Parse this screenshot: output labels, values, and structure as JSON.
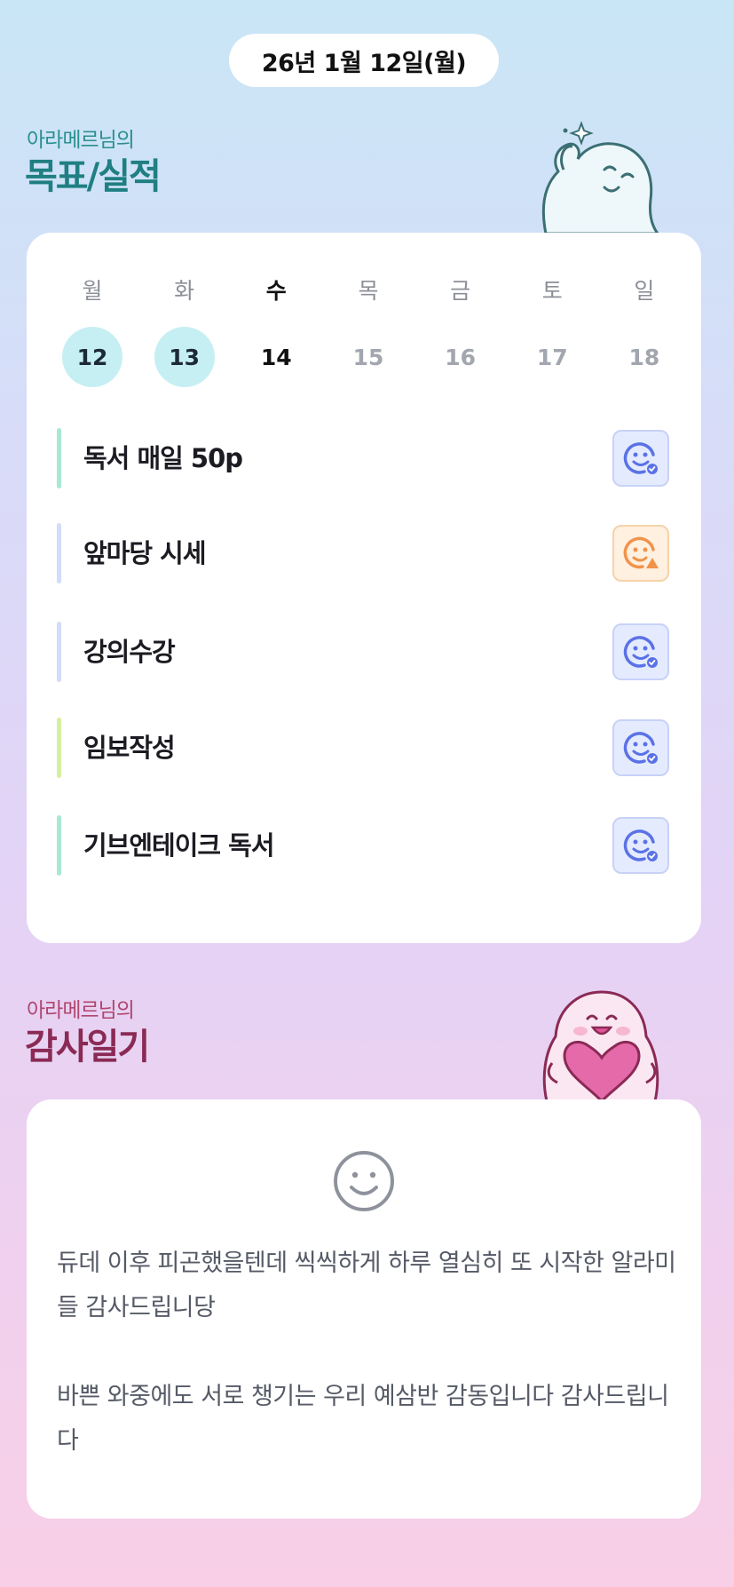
{
  "date_label": "26년 1월 12일(월)",
  "goals_section": {
    "owner": "아라메르님의",
    "title": "목표/실적"
  },
  "week": [
    {
      "name": "월",
      "num": "12",
      "state": "done"
    },
    {
      "name": "화",
      "num": "13",
      "state": "done"
    },
    {
      "name": "수",
      "num": "14",
      "state": "today"
    },
    {
      "name": "목",
      "num": "15",
      "state": "future"
    },
    {
      "name": "금",
      "num": "16",
      "state": "future"
    },
    {
      "name": "토",
      "num": "17",
      "state": "future"
    },
    {
      "name": "일",
      "num": "18",
      "state": "future"
    }
  ],
  "goals": [
    {
      "label": "독서 매일 50p",
      "bar_color": "#a8e8d4",
      "status": "blue",
      "icon": "smile-check-icon"
    },
    {
      "label": "앞마당 시세",
      "bar_color": "#d3dcfa",
      "status": "orange",
      "icon": "smile-warning-icon"
    },
    {
      "label": "강의수강",
      "bar_color": "#d3dcfa",
      "status": "blue",
      "icon": "smile-check-icon"
    },
    {
      "label": "임보작성",
      "bar_color": "#d6ef9e",
      "status": "blue",
      "icon": "smile-check-icon"
    },
    {
      "label": "기브엔테이크 독서",
      "bar_color": "#a8e8d4",
      "status": "blue",
      "icon": "smile-check-icon"
    }
  ],
  "gratitude_section": {
    "owner": "아라메르님의",
    "title": "감사일기"
  },
  "gratitude": {
    "mood_icon": "smile-face-icon",
    "paragraphs": [
      "듀데 이후 피곤했을텐데 씩씩하게 하루 열심히 또 시작한 알라미들 감사드립니당",
      "바쁜 와중에도 서로 챙기는 우리 예삼반 감동입니다 감사드립니다"
    ]
  },
  "colors": {
    "status_blue": "#5a72e6",
    "status_orange": "#f0934a",
    "done_circle": "#c6eff3",
    "goals_title": "#1f7f82",
    "gratitude_title": "#8a2a55"
  }
}
